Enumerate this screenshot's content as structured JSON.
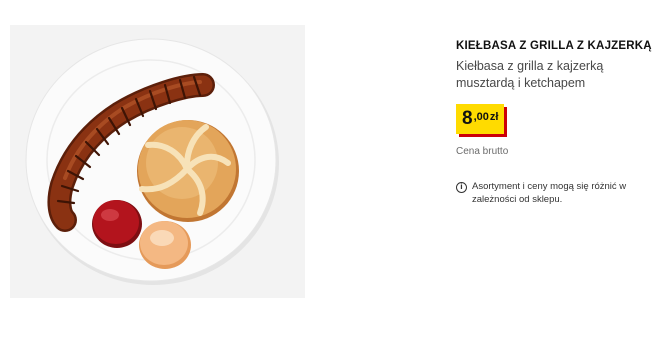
{
  "product": {
    "image_alt": "Kiełbasa z grilla z kajzerką",
    "title": "KIEŁBASA Z GRILLA Z KAJZERKĄ",
    "description": "Kiełbasa z grilla z kajzerką musztardą i ketchapem",
    "price": {
      "integer": "8",
      "decimal": ",00",
      "currency": "zł"
    },
    "price_label": "Cena brutto",
    "notice": {
      "icon": "info-icon",
      "text": "Asortyment i ceny mogą się różnić w zależności od sklepu."
    }
  },
  "colors": {
    "price_bg": "#ffdb00",
    "price_shadow": "#cc0008",
    "plate": "#ffffff",
    "sausage": "#8a3212",
    "ketchup": "#b3141d",
    "mustard_sauce": "#f4b883",
    "roll": "#e3a55a"
  }
}
